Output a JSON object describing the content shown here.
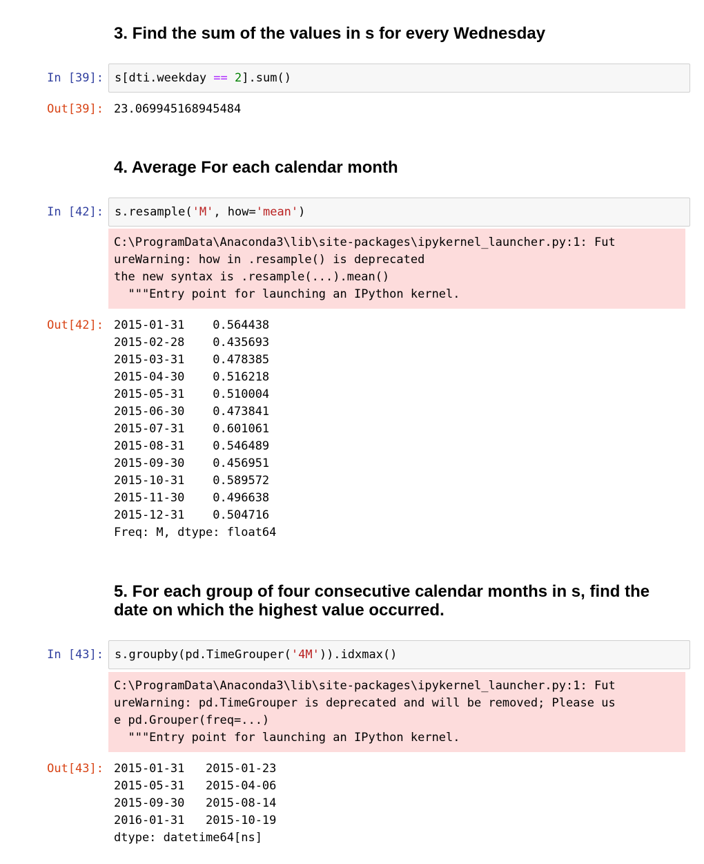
{
  "cells": [
    {
      "heading": "3. Find the sum of the values in s for every Wednesday",
      "in_prompt": "In [39]:",
      "code": {
        "pre": "s[dti.weekday ",
        "op": "==",
        "sp": " ",
        "num": "2",
        "post": "].sum()"
      },
      "out_prompt": "Out[39]:",
      "output": "23.069945168945484"
    },
    {
      "heading": "4. Average For each calendar month",
      "in_prompt": "In [42]:",
      "code": {
        "pre": "s.resample(",
        "s1": "'M'",
        "mid": ", how=",
        "s2": "'mean'",
        "post": ")"
      },
      "warning": "C:\\ProgramData\\Anaconda3\\lib\\site-packages\\ipykernel_launcher.py:1: Fut\nureWarning: how in .resample() is deprecated\nthe new syntax is .resample(...).mean()\n  \"\"\"Entry point for launching an IPython kernel.",
      "out_prompt": "Out[42]:",
      "output": "2015-01-31    0.564438\n2015-02-28    0.435693\n2015-03-31    0.478385\n2015-04-30    0.516218\n2015-05-31    0.510004\n2015-06-30    0.473841\n2015-07-31    0.601061\n2015-08-31    0.546489\n2015-09-30    0.456951\n2015-10-31    0.589572\n2015-11-30    0.496638\n2015-12-31    0.504716\nFreq: M, dtype: float64"
    },
    {
      "heading": "5. For each group of four consecutive calendar months in s, find the date on which the highest value occurred.",
      "in_prompt": "In [43]:",
      "code": {
        "pre": "s.groupby(pd.TimeGrouper(",
        "s1": "'4M'",
        "post": ")).idxmax()"
      },
      "warning": "C:\\ProgramData\\Anaconda3\\lib\\site-packages\\ipykernel_launcher.py:1: Fut\nureWarning: pd.TimeGrouper is deprecated and will be removed; Please us\ne pd.Grouper(freq=...)\n  \"\"\"Entry point for launching an IPython kernel.",
      "out_prompt": "Out[43]:",
      "output": "2015-01-31   2015-01-23\n2015-05-31   2015-04-06\n2015-09-30   2015-08-14\n2016-01-31   2015-10-19\ndtype: datetime64[ns]"
    }
  ]
}
